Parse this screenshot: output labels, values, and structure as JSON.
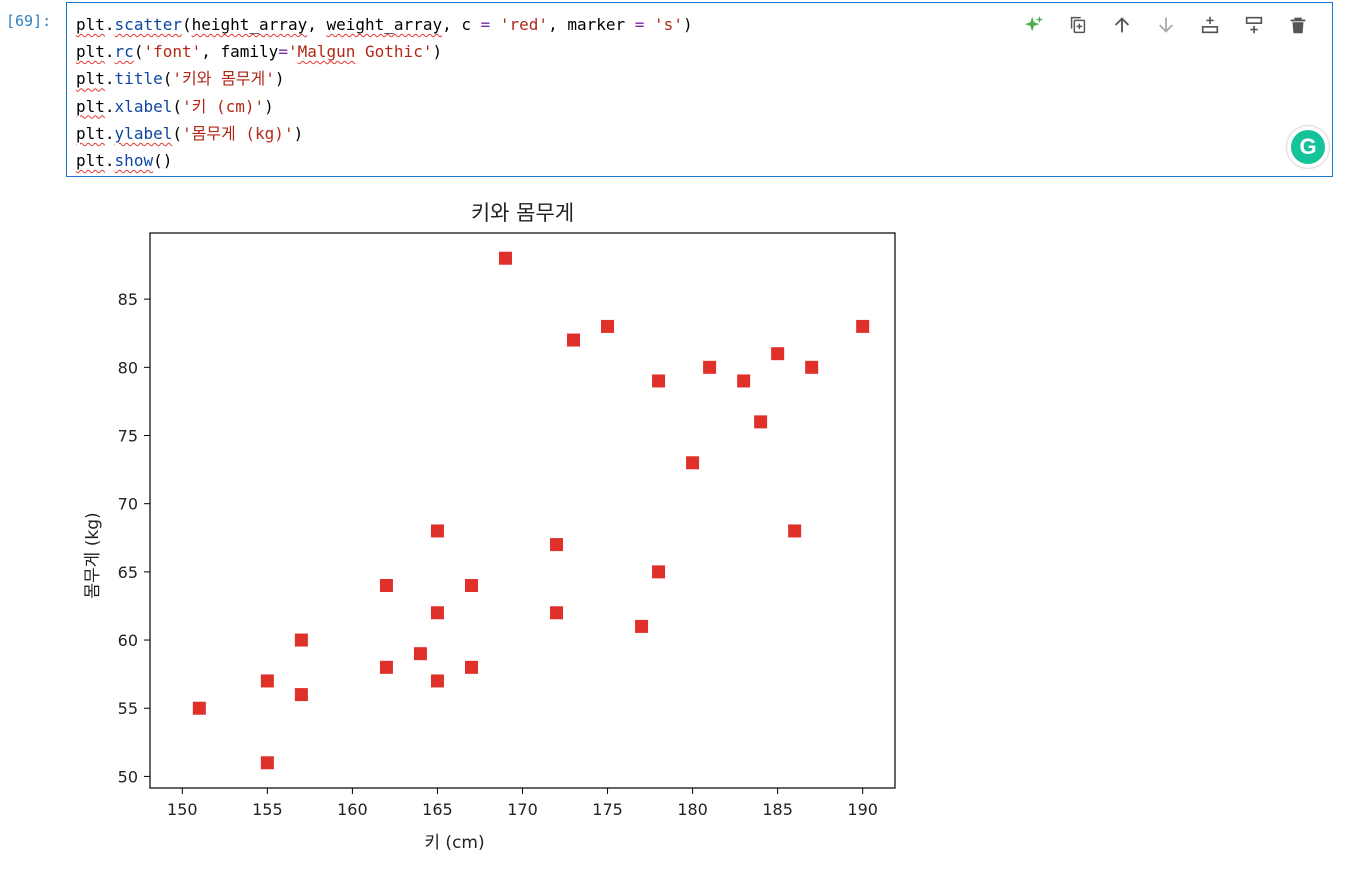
{
  "cell": {
    "prompt": "[69]:",
    "code_lines": [
      [
        {
          "t": "plt",
          "c": "var"
        },
        {
          "t": ".",
          "c": ""
        },
        {
          "t": "scatter",
          "c": "fn var"
        },
        {
          "t": "(",
          "c": ""
        },
        {
          "t": "height_array",
          "c": "var"
        },
        {
          "t": ", ",
          "c": ""
        },
        {
          "t": "weight_array",
          "c": "var"
        },
        {
          "t": ", c ",
          "c": ""
        },
        {
          "t": "=",
          "c": "kw"
        },
        {
          "t": " ",
          "c": ""
        },
        {
          "t": "'red'",
          "c": "str"
        },
        {
          "t": ", marker ",
          "c": ""
        },
        {
          "t": "=",
          "c": "kw"
        },
        {
          "t": " ",
          "c": ""
        },
        {
          "t": "'s'",
          "c": "str"
        },
        {
          "t": ")",
          "c": ""
        }
      ],
      [
        {
          "t": "plt",
          "c": "var"
        },
        {
          "t": ".",
          "c": ""
        },
        {
          "t": "rc",
          "c": "fn var"
        },
        {
          "t": "(",
          "c": ""
        },
        {
          "t": "'font'",
          "c": "str"
        },
        {
          "t": ", family",
          "c": ""
        },
        {
          "t": "=",
          "c": "kw"
        },
        {
          "t": "'",
          "c": "str"
        },
        {
          "t": "Malgun",
          "c": "str var"
        },
        {
          "t": " Gothic'",
          "c": "str"
        },
        {
          "t": ")",
          "c": ""
        }
      ],
      [
        {
          "t": "plt",
          "c": "var"
        },
        {
          "t": ".",
          "c": ""
        },
        {
          "t": "title",
          "c": "fn"
        },
        {
          "t": "(",
          "c": ""
        },
        {
          "t": "'키와 몸무게'",
          "c": "str"
        },
        {
          "t": ")",
          "c": ""
        }
      ],
      [
        {
          "t": "plt",
          "c": "var"
        },
        {
          "t": ".",
          "c": ""
        },
        {
          "t": "xlabel",
          "c": "fn"
        },
        {
          "t": "(",
          "c": ""
        },
        {
          "t": "'키 (cm)'",
          "c": "str"
        },
        {
          "t": ")",
          "c": ""
        }
      ],
      [
        {
          "t": "plt",
          "c": "var"
        },
        {
          "t": ".",
          "c": ""
        },
        {
          "t": "ylabel",
          "c": "fn var"
        },
        {
          "t": "(",
          "c": ""
        },
        {
          "t": "'몸무게 (kg)'",
          "c": "str"
        },
        {
          "t": ")",
          "c": ""
        }
      ],
      [
        {
          "t": "plt",
          "c": "var"
        },
        {
          "t": ".",
          "c": ""
        },
        {
          "t": "show",
          "c": "fn var"
        },
        {
          "t": "()",
          "c": ""
        }
      ]
    ],
    "toolbar_icons": [
      "sparkle-icon",
      "duplicate-icon",
      "arrow-up-icon",
      "arrow-down-icon",
      "insert-above-icon",
      "insert-below-icon",
      "delete-icon"
    ],
    "grammarly_letter": "G"
  },
  "colors": {
    "accent": "#1976d2",
    "marker": "#e0302a",
    "prompt": "#307fc1",
    "sparkle": "#4caf50"
  },
  "chart_data": {
    "type": "scatter",
    "title": "키와 몸무게",
    "xlabel": "키 (cm)",
    "ylabel": "몸무게 (kg)",
    "xlim": [
      148.1,
      191.9
    ],
    "ylim": [
      49.15,
      89.85
    ],
    "xticks": [
      150,
      155,
      160,
      165,
      170,
      175,
      180,
      185,
      190
    ],
    "yticks": [
      50,
      55,
      60,
      65,
      70,
      75,
      80,
      85
    ],
    "marker": "square",
    "color": "red",
    "grid": false,
    "points": [
      [
        151,
        55
      ],
      [
        155,
        57
      ],
      [
        155,
        51
      ],
      [
        157,
        60
      ],
      [
        157,
        56
      ],
      [
        162,
        64
      ],
      [
        162,
        58
      ],
      [
        164,
        59
      ],
      [
        165,
        68
      ],
      [
        165,
        62
      ],
      [
        165,
        57
      ],
      [
        167,
        64
      ],
      [
        167,
        58
      ],
      [
        169,
        88
      ],
      [
        172,
        67
      ],
      [
        172,
        62
      ],
      [
        173,
        82
      ],
      [
        175,
        83
      ],
      [
        177,
        61
      ],
      [
        178,
        79
      ],
      [
        178,
        65
      ],
      [
        180,
        73
      ],
      [
        181,
        80
      ],
      [
        183,
        79
      ],
      [
        184,
        76
      ],
      [
        185,
        81
      ],
      [
        186,
        68
      ],
      [
        187,
        80
      ],
      [
        190,
        83
      ]
    ]
  }
}
